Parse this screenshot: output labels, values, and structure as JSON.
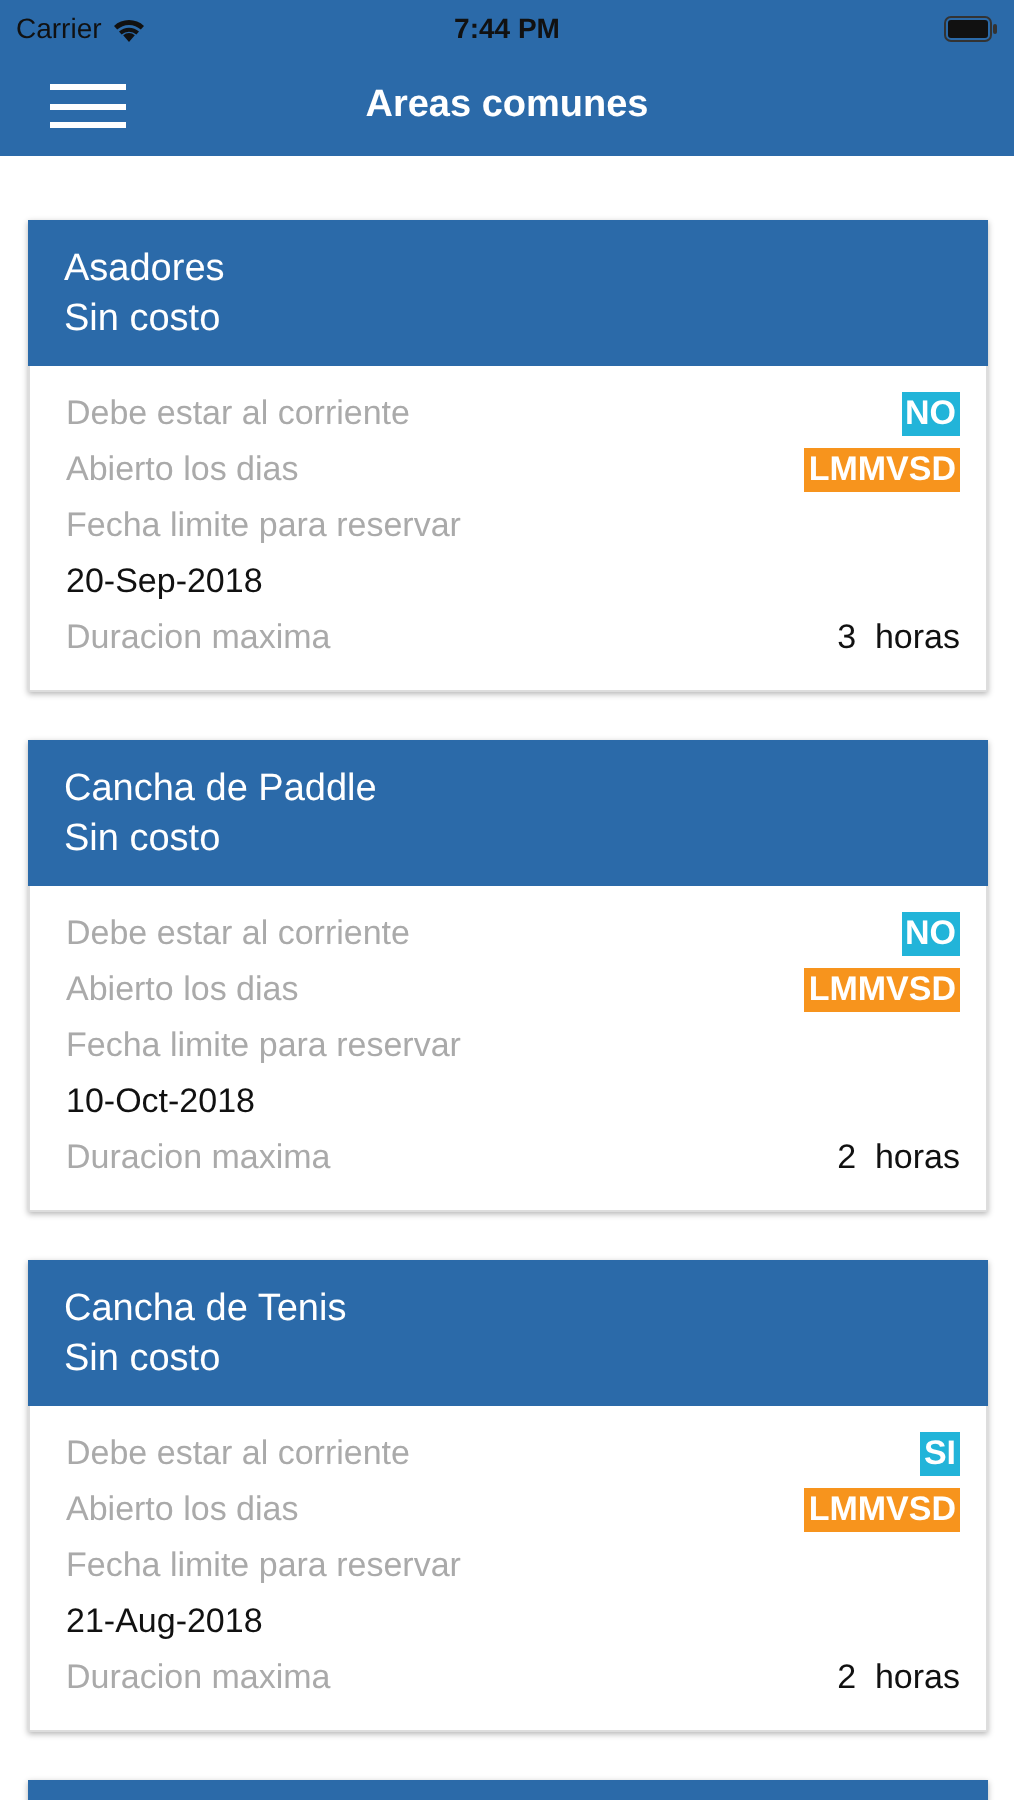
{
  "status_bar": {
    "carrier": "Carrier",
    "time": "7:44 PM"
  },
  "nav_bar": {
    "title": "Areas comunes"
  },
  "areas": [
    {
      "name": "Asadores",
      "cost": "Sin costo",
      "rows": [
        {
          "kind": "badge",
          "label": "Debe estar al corriente",
          "value": "NO",
          "color": "#22b4d9"
        },
        {
          "kind": "badge",
          "label": "Abierto los dias",
          "value": "LMMVSD",
          "color": "#f7941d"
        },
        {
          "kind": "stacked",
          "label": "Fecha limite para reservar",
          "value": "20-Sep-2018"
        },
        {
          "kind": "plain",
          "label": "Duracion maxima",
          "value": "3  horas"
        }
      ]
    },
    {
      "name": "Cancha de Paddle",
      "cost": "Sin costo",
      "rows": [
        {
          "kind": "badge",
          "label": "Debe estar al corriente",
          "value": "NO",
          "color": "#22b4d9"
        },
        {
          "kind": "badge",
          "label": "Abierto los dias",
          "value": "LMMVSD",
          "color": "#f7941d"
        },
        {
          "kind": "stacked",
          "label": "Fecha limite para reservar",
          "value": "10-Oct-2018"
        },
        {
          "kind": "plain",
          "label": "Duracion maxima",
          "value": "2  horas"
        }
      ]
    },
    {
      "name": "Cancha de Tenis",
      "cost": "Sin costo",
      "rows": [
        {
          "kind": "badge",
          "label": "Debe estar al corriente",
          "value": "SI",
          "color": "#22b4d9"
        },
        {
          "kind": "badge",
          "label": "Abierto los dias",
          "value": "LMMVSD",
          "color": "#f7941d"
        },
        {
          "kind": "stacked",
          "label": "Fecha limite para reservar",
          "value": "21-Aug-2018"
        },
        {
          "kind": "plain",
          "label": "Duracion maxima",
          "value": "2  horas"
        }
      ]
    },
    {
      "kind": "cut"
    }
  ]
}
